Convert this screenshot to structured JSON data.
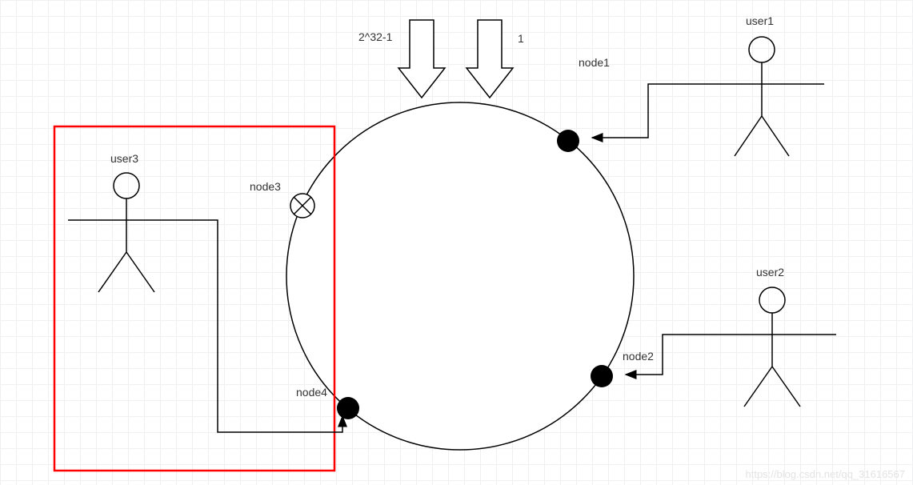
{
  "labels": {
    "user1": "user1",
    "user2": "user2",
    "user3": "user3",
    "node1": "node1",
    "node2": "node2",
    "node3": "node3",
    "node4": "node4",
    "maxHash": "2^32-1",
    "minHash": "1"
  },
  "watermark": "https://blog.csdn.net/qq_31616567",
  "diagram": {
    "description": "Consistent hashing ring. node3 is removed (crossed out). user3 previously mapped to node3 now reroutes to node4 (clockwise). Red box highlights affected region.",
    "ring_range": "[1, 2^32-1]",
    "nodes": [
      {
        "id": "node1",
        "status": "active"
      },
      {
        "id": "node2",
        "status": "active"
      },
      {
        "id": "node3",
        "status": "removed"
      },
      {
        "id": "node4",
        "status": "active"
      }
    ],
    "users": [
      {
        "id": "user1",
        "maps_to": "node1"
      },
      {
        "id": "user2",
        "maps_to": "node2"
      },
      {
        "id": "user3",
        "maps_to": "node4",
        "previously": "node3"
      }
    ]
  }
}
